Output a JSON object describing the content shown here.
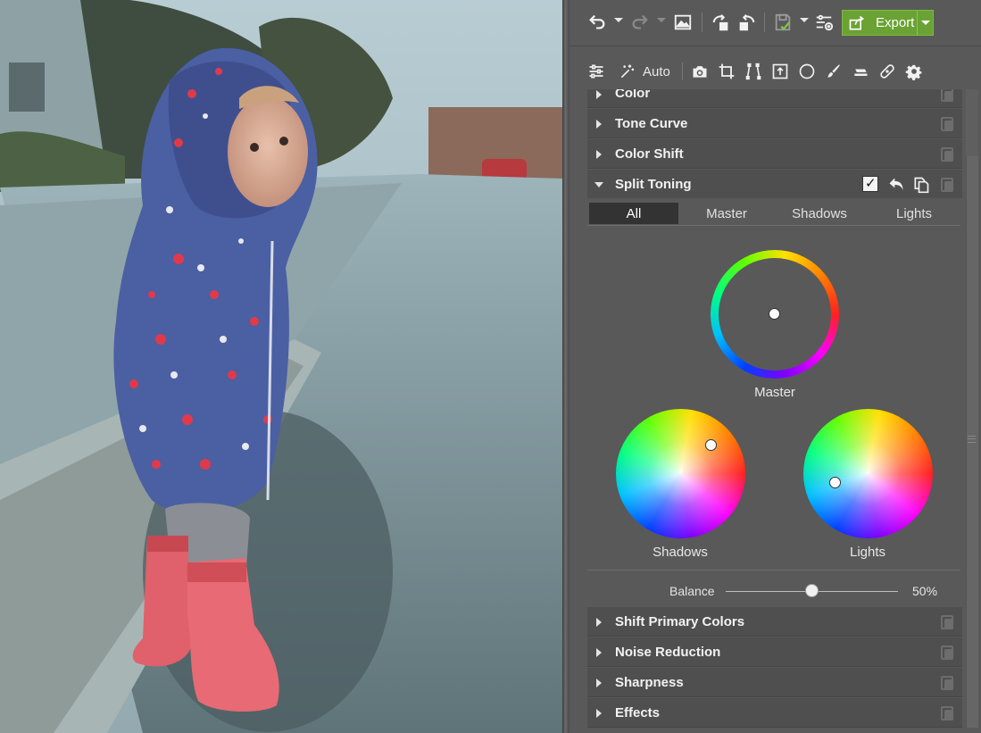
{
  "toolbar": {
    "undo_icon": "undo-icon",
    "redo_icon": "redo-icon",
    "image_icon": "image-icon",
    "rotate_left_icon": "rotate-left-icon",
    "rotate_right_icon": "rotate-right-icon",
    "save_icon": "save-icon",
    "settings_icon": "adjust-settings-icon",
    "export_label": "Export",
    "export_color": "#6aa233"
  },
  "tools": {
    "auto_label": "Auto",
    "items": [
      "sliders-icon",
      "magic-wand-icon",
      "camera-icon",
      "crop-icon",
      "perspective-icon",
      "frame-text-icon",
      "circle-icon",
      "brush-icon",
      "eraser-icon",
      "bandage-icon",
      "gear-icon"
    ]
  },
  "sections": {
    "color": "Color",
    "tone_curve": "Tone Curve",
    "color_shift": "Color Shift",
    "split_toning": "Split Toning",
    "shift_primary_colors": "Shift Primary Colors",
    "noise_reduction": "Noise Reduction",
    "sharpness": "Sharpness",
    "effects": "Effects"
  },
  "split_toning": {
    "tabs": [
      "All",
      "Master",
      "Shadows",
      "Lights"
    ],
    "active_tab": "All",
    "master_label": "Master",
    "shadows_label": "Shadows",
    "lights_label": "Lights",
    "balance_label": "Balance",
    "balance_value": "50%",
    "balance_fraction": 0.5
  }
}
